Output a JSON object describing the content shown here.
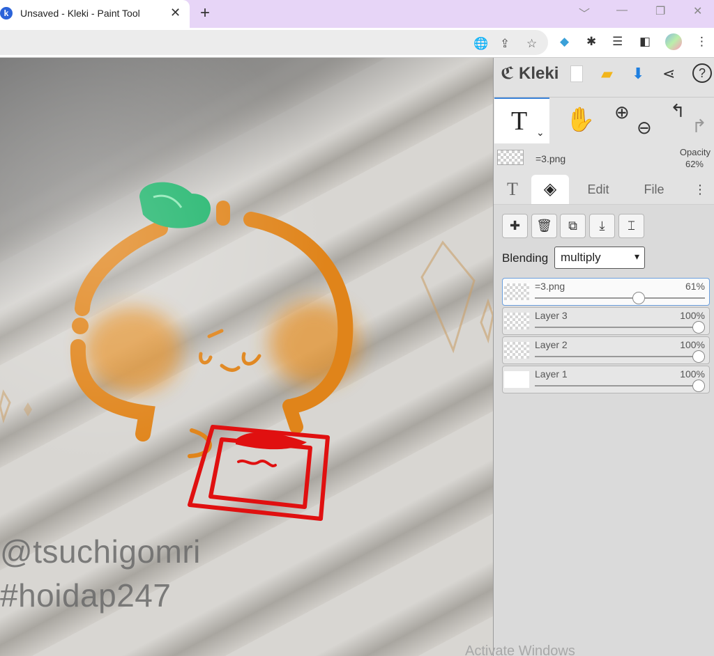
{
  "browser": {
    "tab_title": "Unsaved - Kleki - Paint Tool",
    "tab_close": "✕",
    "new_tab": "+",
    "controls": [
      "﹀",
      "—",
      "❐",
      "✕"
    ]
  },
  "canvas": {
    "watermark_line1": "@tsuchigomri",
    "watermark_line2": "#hoidap247",
    "os_overlay": "Activate Windows"
  },
  "app": {
    "brand": "Kleki",
    "toolbar_icons": [
      "new-document-icon",
      "open-folder-icon",
      "download-icon",
      "share-icon",
      "help-icon"
    ],
    "tool": {
      "active": "T",
      "chevron": "⌄",
      "hand": "✋",
      "zoom_in": "⊕",
      "zoom_out": "⊖",
      "undo": "↰",
      "redo": "↱"
    },
    "current_layer": {
      "name": "=3.png",
      "opacity_label": "Opacity",
      "opacity_value": "62%"
    },
    "tabs": [
      {
        "label": "T",
        "active": false
      },
      {
        "label": "layers",
        "active": true
      },
      {
        "label": "Edit",
        "active": false
      },
      {
        "label": "File",
        "active": false
      }
    ],
    "more_icon": "⋮",
    "layer_actions": {
      "add": "✚",
      "delete": "🗑",
      "duplicate": "⧉",
      "merge": "⤓",
      "rename": "⌶"
    },
    "blending": {
      "label": "Blending",
      "value": "multiply",
      "caret": "▾"
    },
    "layers": [
      {
        "name": "=3.png",
        "opacity": "61%",
        "level": 0.61,
        "selected": true
      },
      {
        "name": "Layer 3",
        "opacity": "100%",
        "level": 1.0,
        "selected": false
      },
      {
        "name": "Layer 2",
        "opacity": "100%",
        "level": 1.0,
        "selected": false
      },
      {
        "name": "Layer 1",
        "opacity": "100%",
        "level": 1.0,
        "selected": false
      }
    ]
  },
  "colors": {
    "accent": "#3b82d8",
    "panel_bg": "#e2e2e2",
    "tabstrip": "#e7d5f7",
    "download_blue": "#1e7fe0",
    "folder_yellow": "#f2b51b"
  }
}
